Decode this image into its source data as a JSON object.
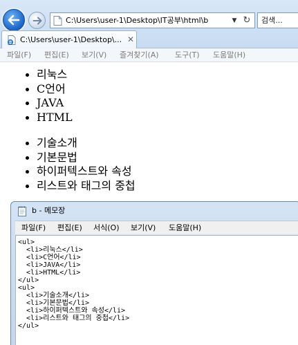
{
  "browser": {
    "address": "C:\\Users\\user-1\\Desktop\\IT공부\\html\\b",
    "search_placeholder": "검색...",
    "tab_title": "C:\\Users\\user-1\\Desktop\\...",
    "menu": [
      "파일(F)",
      "편집(E)",
      "보기(V)",
      "즐겨찾기(A)",
      "도구(T)",
      "도움말(H)"
    ],
    "icons": {
      "back": "back-arrow-icon",
      "forward": "forward-arrow-icon",
      "refresh": "refresh-icon",
      "dropdown": "dropdown-arrow-icon",
      "tab_close": "close-icon"
    }
  },
  "page": {
    "list1": [
      "리눅스",
      "C언어",
      "JAVA",
      "HTML"
    ],
    "list2": [
      "기술소개",
      "기본문법",
      "하이퍼텍스트와 속성",
      "리스트와 태그의 중첩"
    ]
  },
  "notepad": {
    "title": "b - 메모장",
    "menu": [
      "파일(F)",
      "편집(E)",
      "서식(O)",
      "보기(V)",
      "도움말(H)"
    ],
    "lines": [
      "<ul>",
      "  <li>리눅스</li>",
      "  <li>C언어</li>",
      "  <li>JAVA</li>",
      "  <li>HTML</li>",
      "</ul>",
      "<ul>",
      "  <li>기술소개</li>",
      "  <li>기본문법</li>",
      "  <li>하이퍼텍스트와 속성</li>",
      "  <li>리스트와 태그의 중첩</li>",
      "</ul>"
    ]
  },
  "colors": {
    "accent": "#1b63c6",
    "menu_text_disabled": "#7b7b7b"
  }
}
